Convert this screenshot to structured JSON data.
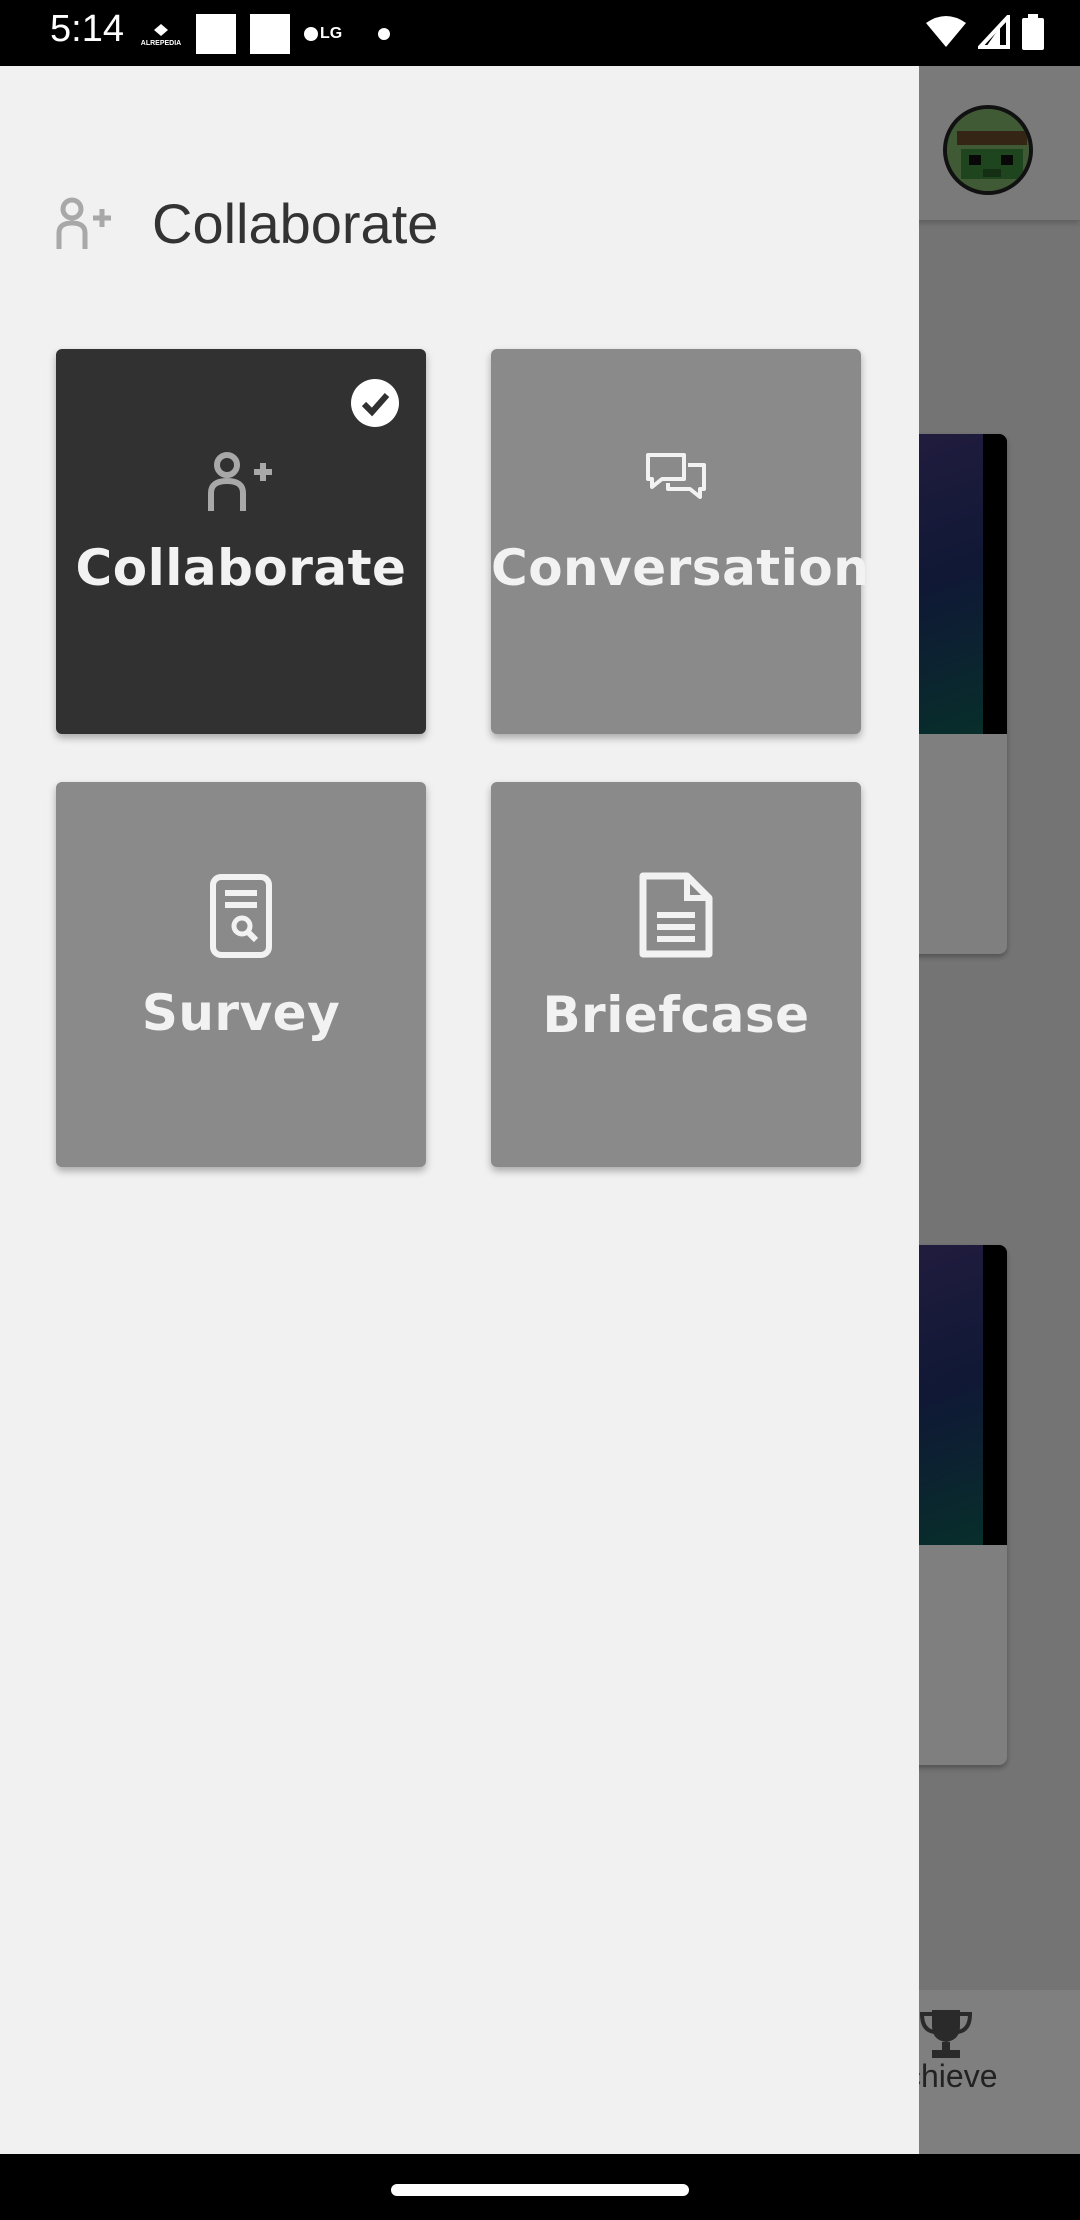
{
  "status_bar": {
    "time": "5:14",
    "app_label": "ALREPEDIA",
    "lg_label": "LG"
  },
  "background": {
    "bottom_nav_label": "chieve"
  },
  "drawer": {
    "header_title": "Collaborate",
    "tiles": [
      {
        "label": "Collaborate",
        "selected": true,
        "icon": "add-person-icon"
      },
      {
        "label": "Conversation",
        "selected": false,
        "icon": "chat-bubbles-icon"
      },
      {
        "label": "Survey",
        "selected": false,
        "icon": "survey-search-icon"
      },
      {
        "label": "Briefcase",
        "selected": false,
        "icon": "document-icon"
      }
    ]
  },
  "colors": {
    "drawer_bg": "#f1f1f1",
    "tile_active": "#313131",
    "tile_inactive": "#8a8a8b",
    "tile_text": "#f2f2f2"
  }
}
